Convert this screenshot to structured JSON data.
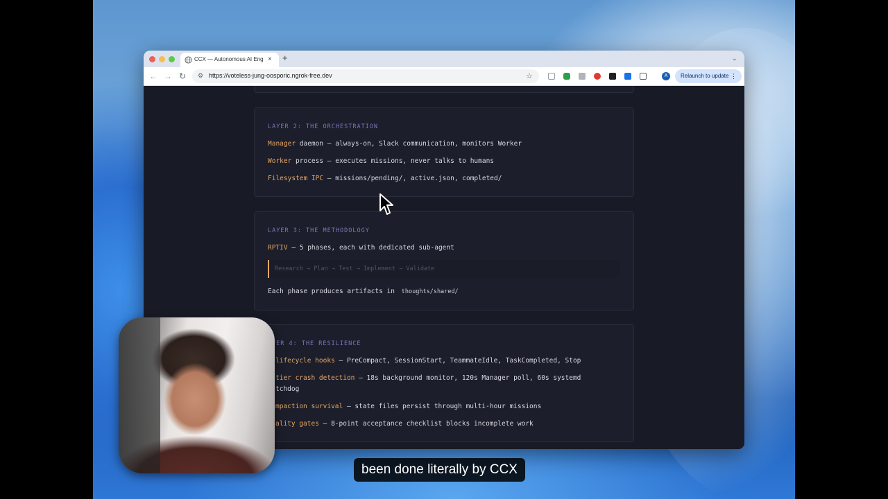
{
  "browser": {
    "tab_title": "CCX — Autonomous AI Engin",
    "tab_close": "×",
    "new_tab": "+",
    "tab_menu": "⌄",
    "url": "https://voteless-jung-oosporic.ngrok-free.dev",
    "relaunch_label": "Relaunch to update",
    "relaunch_menu": "⋮",
    "profile_initial": "A",
    "nav": {
      "back": "←",
      "forward": "→",
      "reload": "↻",
      "site_info": "⚙",
      "bookmark": "☆"
    }
  },
  "cards": {
    "layer2": {
      "label": "LAYER 2: THE ORCHESTRATION",
      "items": [
        {
          "key": "Manager",
          "text": " daemon — always-on, Slack communication, monitors Worker"
        },
        {
          "key": "Worker",
          "text": " process — executes missions, never talks to humans"
        },
        {
          "key": "Filesystem IPC",
          "text": " — missions/pending/, active.json, completed/"
        }
      ]
    },
    "layer3": {
      "label": "LAYER 3: THE METHODOLOGY",
      "lead_key": "RPTIV",
      "lead_text": " — 5 phases, each with dedicated sub-agent",
      "flow": "Research → Plan → Test → Implement → Validate",
      "artifacts_text": "Each phase produces artifacts in",
      "artifacts_path": "thoughts/shared/"
    },
    "layer4": {
      "label": "YER 4: THE RESILIENCE",
      "items": [
        {
          "key": "lifecycle hooks",
          "text": " — PreCompact, SessionStart, TeammateIdle, TaskCompleted, Stop"
        },
        {
          "key": "tier crash detection",
          "text": " — 18s background monitor, 120s Manager poll, 60s systemd"
        },
        {
          "key": "",
          "text": "tchdog"
        },
        {
          "key": "mpaction survival",
          "text": " — state files persist through multi-hour missions"
        },
        {
          "key": "ality gates",
          "text": " — 8-point acceptance checklist blocks incomplete work"
        }
      ]
    }
  },
  "caption": "been done literally by CCX",
  "colors": {
    "page_bg": "#181a26",
    "card_bg": "#1c1e2b",
    "label": "#7b76b8",
    "highlight": "#e6a765",
    "text": "#d8d9e0",
    "relaunch_bg": "#d3e3fd"
  }
}
